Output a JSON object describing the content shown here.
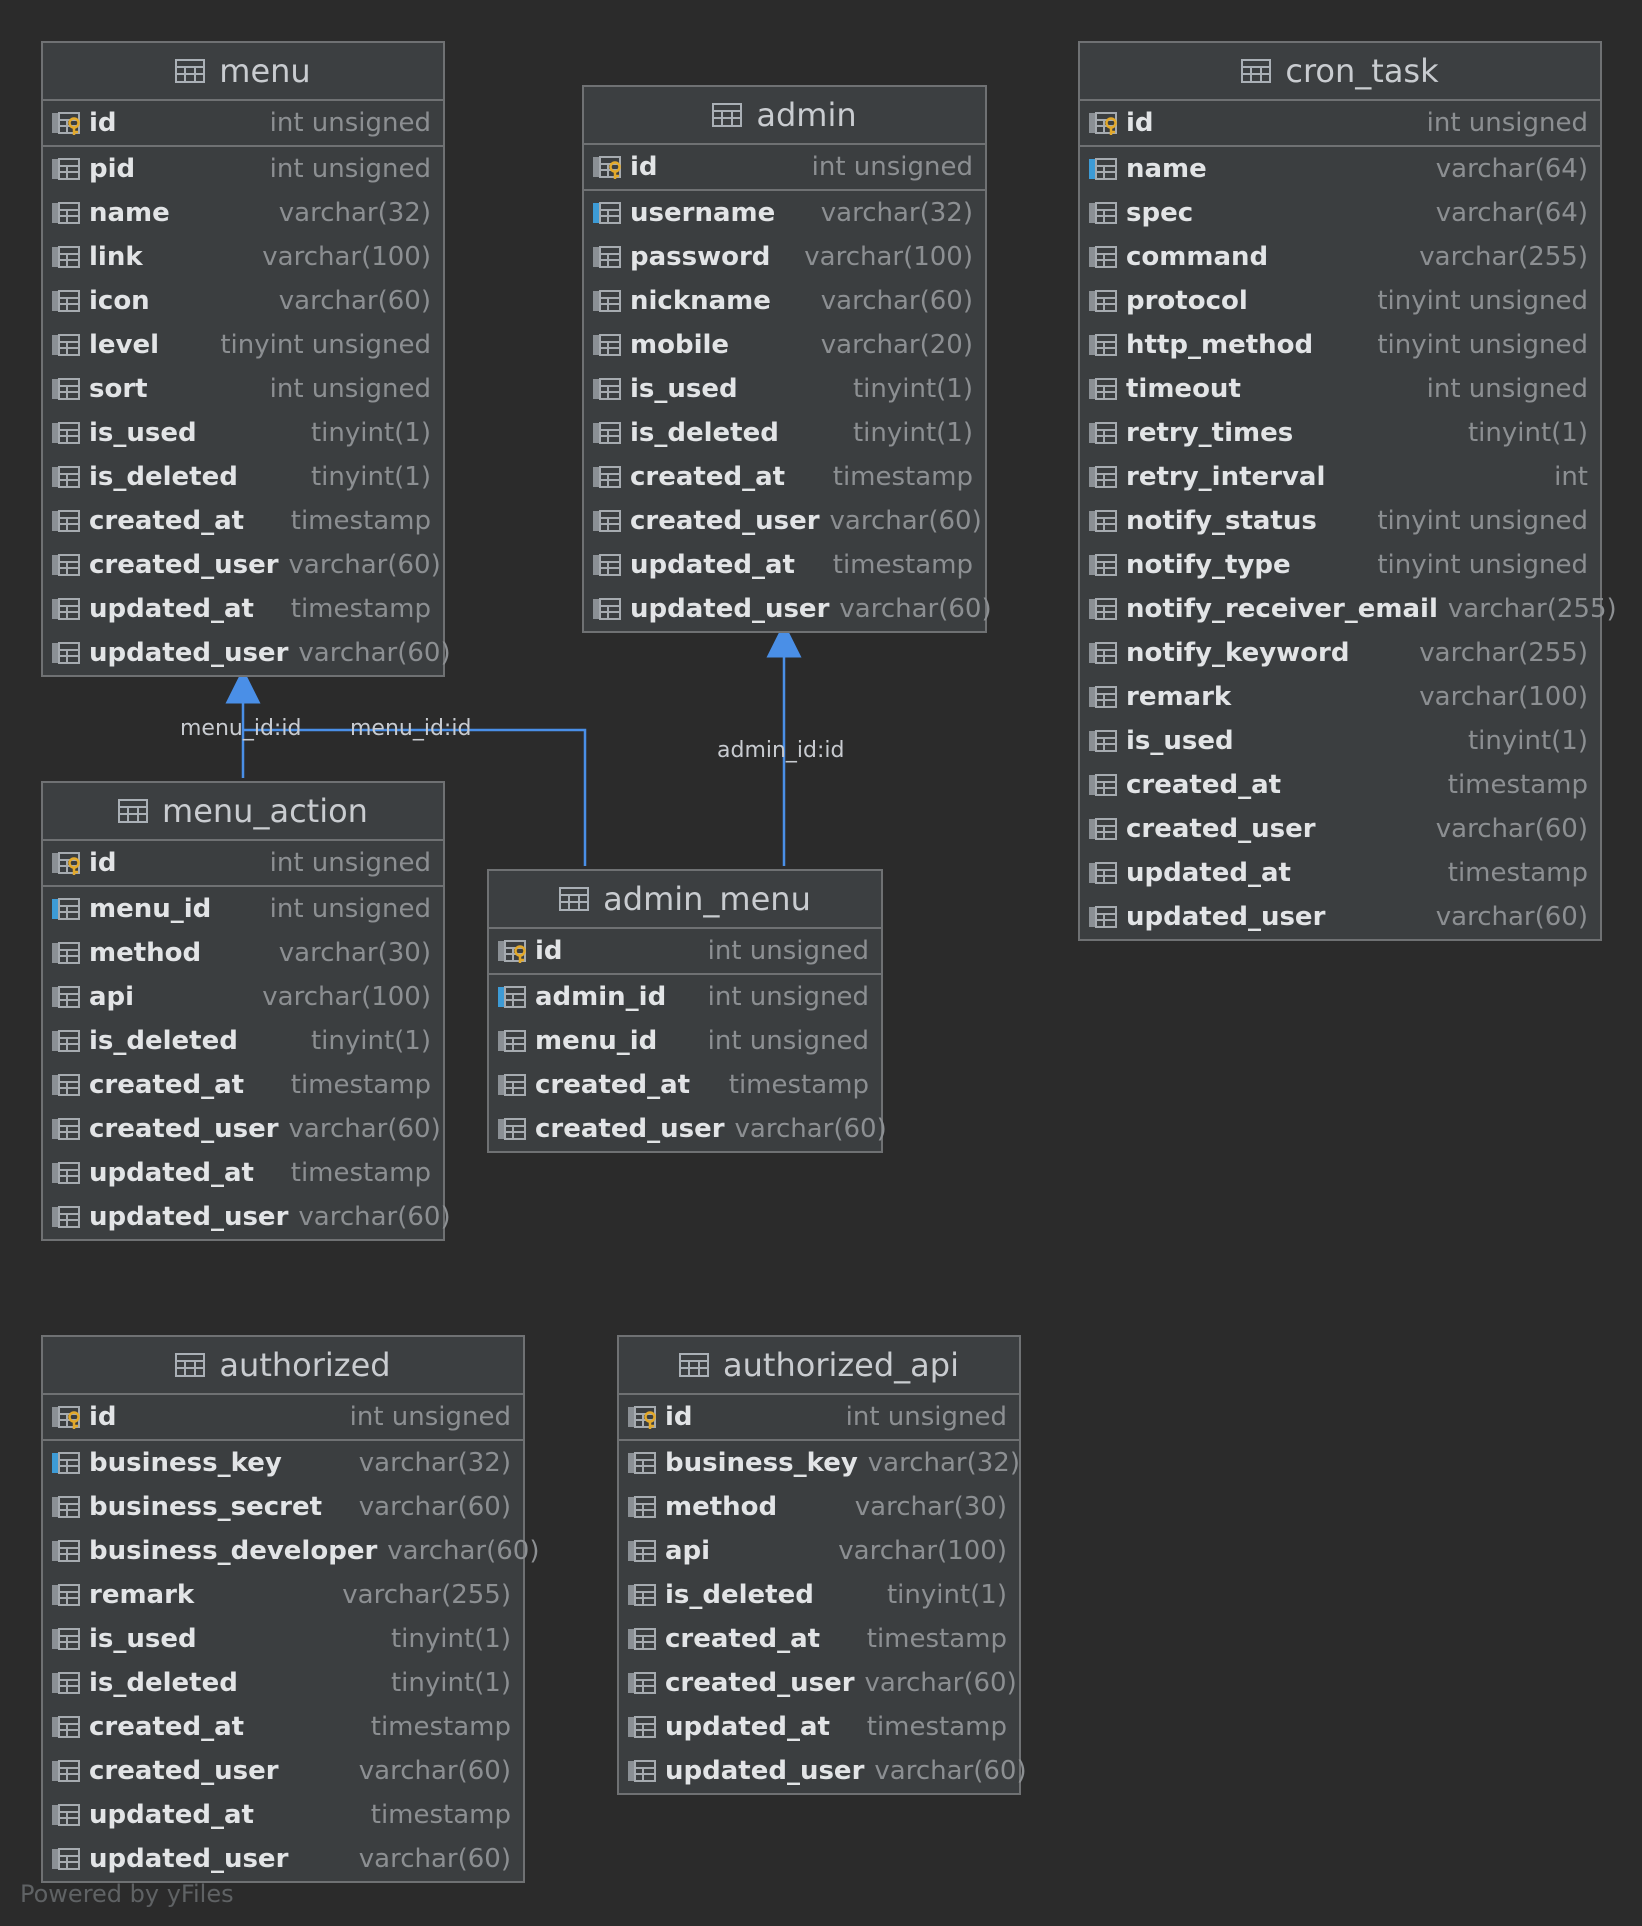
{
  "tables": [
    {
      "id": "menu",
      "name": "menu",
      "columns": [
        {
          "name": "id",
          "type": "int unsigned",
          "kind": "pk"
        },
        {
          "name": "pid",
          "type": "int unsigned",
          "kind": "col"
        },
        {
          "name": "name",
          "type": "varchar(32)",
          "kind": "col"
        },
        {
          "name": "link",
          "type": "varchar(100)",
          "kind": "col"
        },
        {
          "name": "icon",
          "type": "varchar(60)",
          "kind": "col"
        },
        {
          "name": "level",
          "type": "tinyint unsigned",
          "kind": "col"
        },
        {
          "name": "sort",
          "type": "int unsigned",
          "kind": "col"
        },
        {
          "name": "is_used",
          "type": "tinyint(1)",
          "kind": "col"
        },
        {
          "name": "is_deleted",
          "type": "tinyint(1)",
          "kind": "col"
        },
        {
          "name": "created_at",
          "type": "timestamp",
          "kind": "col"
        },
        {
          "name": "created_user",
          "type": "varchar(60)",
          "kind": "col"
        },
        {
          "name": "updated_at",
          "type": "timestamp",
          "kind": "col"
        },
        {
          "name": "updated_user",
          "type": "varchar(60)",
          "kind": "col"
        }
      ]
    },
    {
      "id": "admin",
      "name": "admin",
      "columns": [
        {
          "name": "id",
          "type": "int unsigned",
          "kind": "pk"
        },
        {
          "name": "username",
          "type": "varchar(32)",
          "kind": "idx"
        },
        {
          "name": "password",
          "type": "varchar(100)",
          "kind": "col"
        },
        {
          "name": "nickname",
          "type": "varchar(60)",
          "kind": "col"
        },
        {
          "name": "mobile",
          "type": "varchar(20)",
          "kind": "col"
        },
        {
          "name": "is_used",
          "type": "tinyint(1)",
          "kind": "col"
        },
        {
          "name": "is_deleted",
          "type": "tinyint(1)",
          "kind": "col"
        },
        {
          "name": "created_at",
          "type": "timestamp",
          "kind": "col"
        },
        {
          "name": "created_user",
          "type": "varchar(60)",
          "kind": "col"
        },
        {
          "name": "updated_at",
          "type": "timestamp",
          "kind": "col"
        },
        {
          "name": "updated_user",
          "type": "varchar(60)",
          "kind": "col"
        }
      ]
    },
    {
      "id": "cron_task",
      "name": "cron_task",
      "columns": [
        {
          "name": "id",
          "type": "int unsigned",
          "kind": "pk"
        },
        {
          "name": "name",
          "type": "varchar(64)",
          "kind": "idx"
        },
        {
          "name": "spec",
          "type": "varchar(64)",
          "kind": "col"
        },
        {
          "name": "command",
          "type": "varchar(255)",
          "kind": "col"
        },
        {
          "name": "protocol",
          "type": "tinyint unsigned",
          "kind": "col"
        },
        {
          "name": "http_method",
          "type": "tinyint unsigned",
          "kind": "col"
        },
        {
          "name": "timeout",
          "type": "int unsigned",
          "kind": "col"
        },
        {
          "name": "retry_times",
          "type": "tinyint(1)",
          "kind": "col"
        },
        {
          "name": "retry_interval",
          "type": "int",
          "kind": "col"
        },
        {
          "name": "notify_status",
          "type": "tinyint unsigned",
          "kind": "col"
        },
        {
          "name": "notify_type",
          "type": "tinyint unsigned",
          "kind": "col"
        },
        {
          "name": "notify_receiver_email",
          "type": "varchar(255)",
          "kind": "col"
        },
        {
          "name": "notify_keyword",
          "type": "varchar(255)",
          "kind": "col"
        },
        {
          "name": "remark",
          "type": "varchar(100)",
          "kind": "col"
        },
        {
          "name": "is_used",
          "type": "tinyint(1)",
          "kind": "col"
        },
        {
          "name": "created_at",
          "type": "timestamp",
          "kind": "col"
        },
        {
          "name": "created_user",
          "type": "varchar(60)",
          "kind": "col"
        },
        {
          "name": "updated_at",
          "type": "timestamp",
          "kind": "col"
        },
        {
          "name": "updated_user",
          "type": "varchar(60)",
          "kind": "col"
        }
      ]
    },
    {
      "id": "menu_action",
      "name": "menu_action",
      "columns": [
        {
          "name": "id",
          "type": "int unsigned",
          "kind": "pk"
        },
        {
          "name": "menu_id",
          "type": "int unsigned",
          "kind": "idx"
        },
        {
          "name": "method",
          "type": "varchar(30)",
          "kind": "col"
        },
        {
          "name": "api",
          "type": "varchar(100)",
          "kind": "col"
        },
        {
          "name": "is_deleted",
          "type": "tinyint(1)",
          "kind": "col"
        },
        {
          "name": "created_at",
          "type": "timestamp",
          "kind": "col"
        },
        {
          "name": "created_user",
          "type": "varchar(60)",
          "kind": "col"
        },
        {
          "name": "updated_at",
          "type": "timestamp",
          "kind": "col"
        },
        {
          "name": "updated_user",
          "type": "varchar(60)",
          "kind": "col"
        }
      ]
    },
    {
      "id": "admin_menu",
      "name": "admin_menu",
      "columns": [
        {
          "name": "id",
          "type": "int unsigned",
          "kind": "pk"
        },
        {
          "name": "admin_id",
          "type": "int unsigned",
          "kind": "idx"
        },
        {
          "name": "menu_id",
          "type": "int unsigned",
          "kind": "col"
        },
        {
          "name": "created_at",
          "type": "timestamp",
          "kind": "col"
        },
        {
          "name": "created_user",
          "type": "varchar(60)",
          "kind": "col"
        }
      ]
    },
    {
      "id": "authorized",
      "name": "authorized",
      "columns": [
        {
          "name": "id",
          "type": "int unsigned",
          "kind": "pk"
        },
        {
          "name": "business_key",
          "type": "varchar(32)",
          "kind": "idx"
        },
        {
          "name": "business_secret",
          "type": "varchar(60)",
          "kind": "col"
        },
        {
          "name": "business_developer",
          "type": "varchar(60)",
          "kind": "col"
        },
        {
          "name": "remark",
          "type": "varchar(255)",
          "kind": "col"
        },
        {
          "name": "is_used",
          "type": "tinyint(1)",
          "kind": "col"
        },
        {
          "name": "is_deleted",
          "type": "tinyint(1)",
          "kind": "col"
        },
        {
          "name": "created_at",
          "type": "timestamp",
          "kind": "col"
        },
        {
          "name": "created_user",
          "type": "varchar(60)",
          "kind": "col"
        },
        {
          "name": "updated_at",
          "type": "timestamp",
          "kind": "col"
        },
        {
          "name": "updated_user",
          "type": "varchar(60)",
          "kind": "col"
        }
      ]
    },
    {
      "id": "authorized_api",
      "name": "authorized_api",
      "columns": [
        {
          "name": "id",
          "type": "int unsigned",
          "kind": "pk"
        },
        {
          "name": "business_key",
          "type": "varchar(32)",
          "kind": "col"
        },
        {
          "name": "method",
          "type": "varchar(30)",
          "kind": "col"
        },
        {
          "name": "api",
          "type": "varchar(100)",
          "kind": "col"
        },
        {
          "name": "is_deleted",
          "type": "tinyint(1)",
          "kind": "col"
        },
        {
          "name": "created_at",
          "type": "timestamp",
          "kind": "col"
        },
        {
          "name": "created_user",
          "type": "varchar(60)",
          "kind": "col"
        },
        {
          "name": "updated_at",
          "type": "timestamp",
          "kind": "col"
        },
        {
          "name": "updated_user",
          "type": "varchar(60)",
          "kind": "col"
        }
      ]
    }
  ],
  "relations": [
    {
      "label": "menu_id:id",
      "from": "menu_action",
      "to": "menu"
    },
    {
      "label": "menu_id:id",
      "from": "admin_menu",
      "to": "menu"
    },
    {
      "label": "admin_id:id",
      "from": "admin_menu",
      "to": "admin"
    }
  ],
  "footer": "Powered by yFiles",
  "colors": {
    "background": "#2b2b2b",
    "table_bg": "#3b3e40",
    "border": "#6f7173",
    "link": "#4a8fe7",
    "pk_key": "#e3a92b",
    "idx_mark": "#3d9bd6"
  }
}
